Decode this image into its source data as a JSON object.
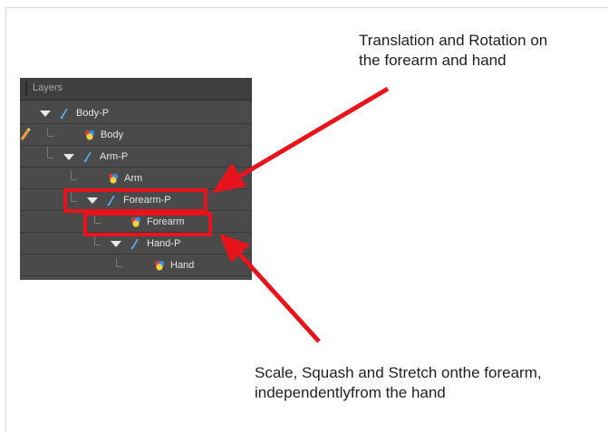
{
  "captions": {
    "top": [
      "Translation and Rotation on",
      "the forearm and hand"
    ],
    "bottom": [
      "Scale, Squash and Stretch onthe forearm,",
      "independentlyfrom the hand"
    ]
  },
  "panel": {
    "title": "Layers",
    "layers": [
      {
        "label": "Body-P",
        "type": "peg",
        "expanded": true
      },
      {
        "label": "Body",
        "type": "drawing"
      },
      {
        "label": "Arm-P",
        "type": "peg",
        "expanded": true
      },
      {
        "label": "Arm",
        "type": "drawing"
      },
      {
        "label": "Forearm-P",
        "type": "peg",
        "expanded": true
      },
      {
        "label": "Forearm",
        "type": "drawing"
      },
      {
        "label": "Hand-P",
        "type": "peg",
        "expanded": true
      },
      {
        "label": "Hand",
        "type": "drawing"
      }
    ]
  },
  "colors": {
    "highlight": "#e8141c",
    "panel_bg": "#4a4a4a",
    "peg_icon": "#5ab4ff"
  },
  "icons": {
    "peg": "peg-icon",
    "drawing": "drawing-layer-icon",
    "expand": "expand-triangle-icon",
    "pencil": "pencil-icon"
  }
}
